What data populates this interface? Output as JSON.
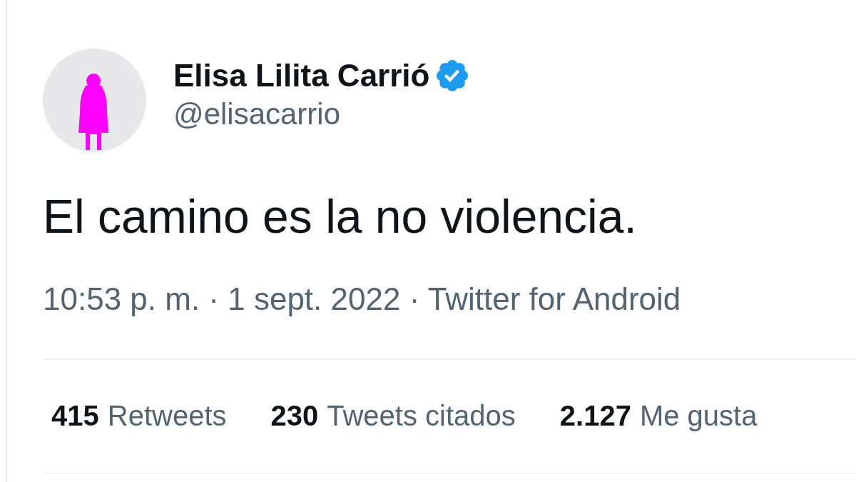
{
  "author": {
    "name": "Elisa Lilita Carrió",
    "verified": true,
    "handle": "@elisacarrio"
  },
  "tweet": {
    "text": "El camino es la no violencia.",
    "meta": "10:53 p. m. · 1 sept. 2022 · Twitter for Android"
  },
  "stats": [
    {
      "count": "415",
      "label": "Retweets"
    },
    {
      "count": "230",
      "label": "Tweets citados"
    },
    {
      "count": "2.127",
      "label": "Me gusta"
    }
  ]
}
